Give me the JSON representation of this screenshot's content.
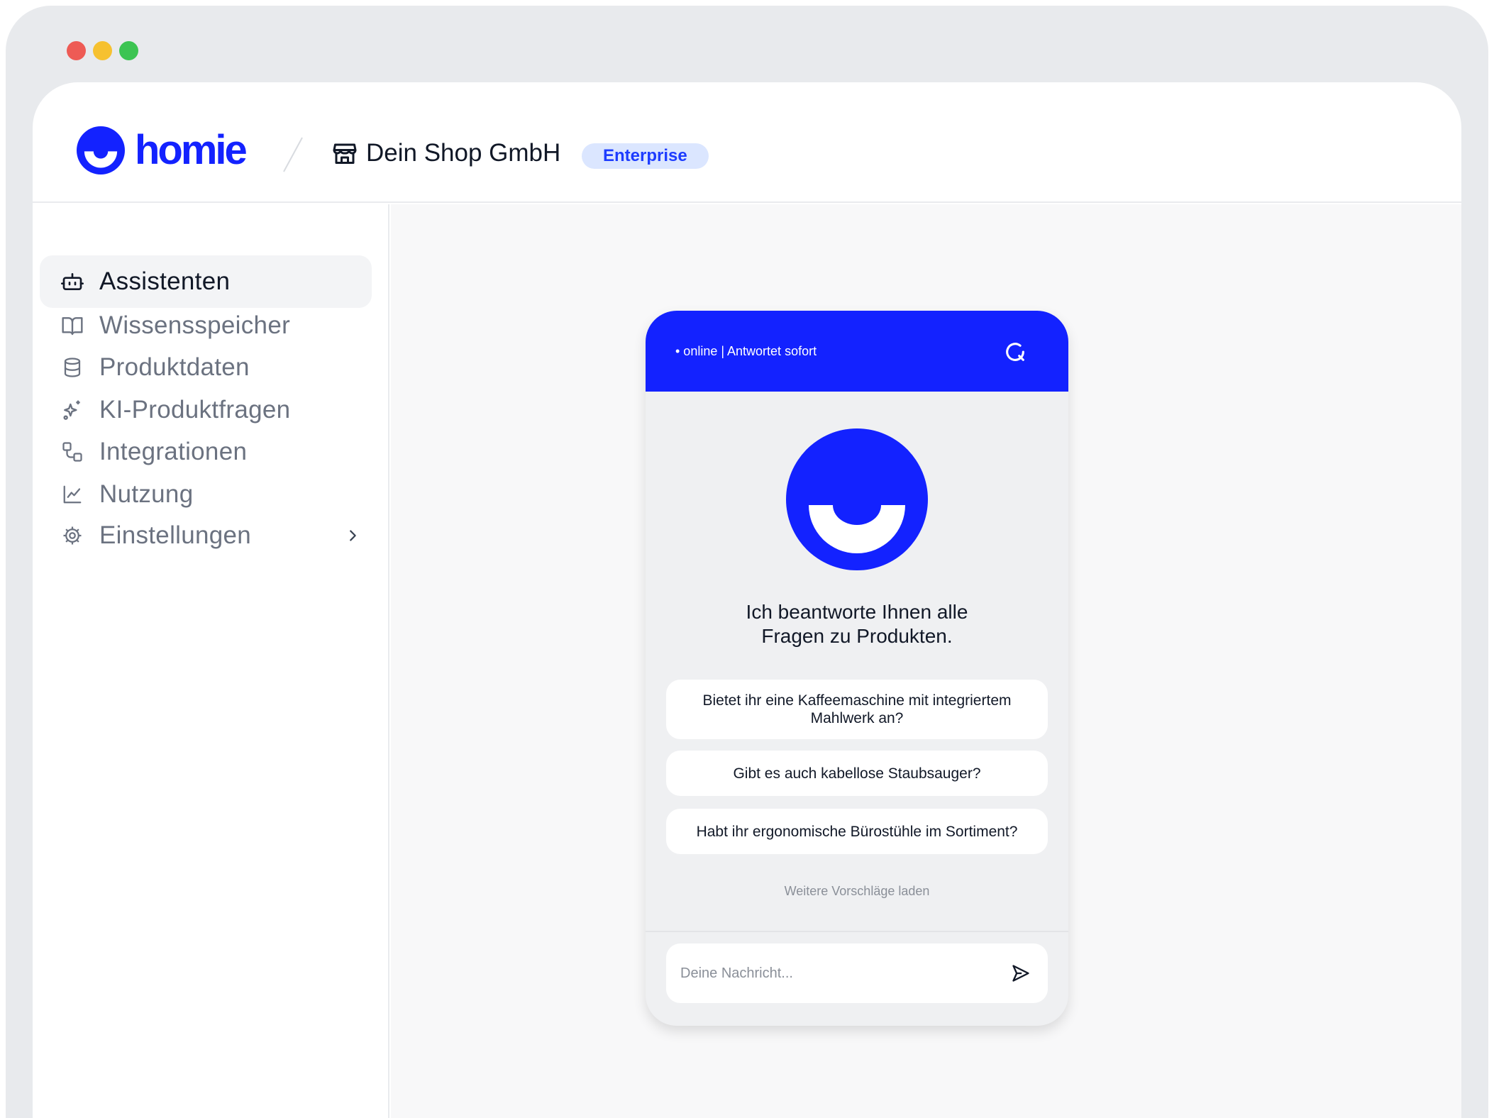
{
  "window": {
    "traffic_lights": [
      "close",
      "minimize",
      "maximize"
    ]
  },
  "brand": {
    "name": "homie",
    "color": "#1322ff"
  },
  "header": {
    "shop_name": "Dein Shop GmbH",
    "badge": "Enterprise",
    "shop_icon": "store-icon"
  },
  "sidebar": {
    "items": [
      {
        "label": "Assistenten",
        "icon": "robot-icon",
        "active": true
      },
      {
        "label": "Wissensspeicher",
        "icon": "book-icon"
      },
      {
        "label": "Produktdaten",
        "icon": "database-icon"
      },
      {
        "label": "KI-Produktfragen",
        "icon": "sparkles-icon"
      },
      {
        "label": "Integrationen",
        "icon": "integrations-icon"
      },
      {
        "label": "Nutzung",
        "icon": "chart-line-icon"
      },
      {
        "label": "Einstellungen",
        "icon": "gear-icon",
        "has_submenu": true
      }
    ]
  },
  "widget": {
    "status": "• online | Antwortet sofort",
    "greeting_line1": "Ich beantworte Ihnen alle",
    "greeting_line2": "Fragen zu Produkten.",
    "suggestions": [
      "Bietet ihr eine Kaffeemaschine mit integriertem Mahlwerk an?",
      "Gibt es auch kabellose Staubsauger?",
      "Habt ihr ergonomische Bürostühle im Sortiment?"
    ],
    "more_label": "Weitere Vorschläge laden",
    "input_placeholder": "Deine Nachricht...",
    "input_value": ""
  }
}
